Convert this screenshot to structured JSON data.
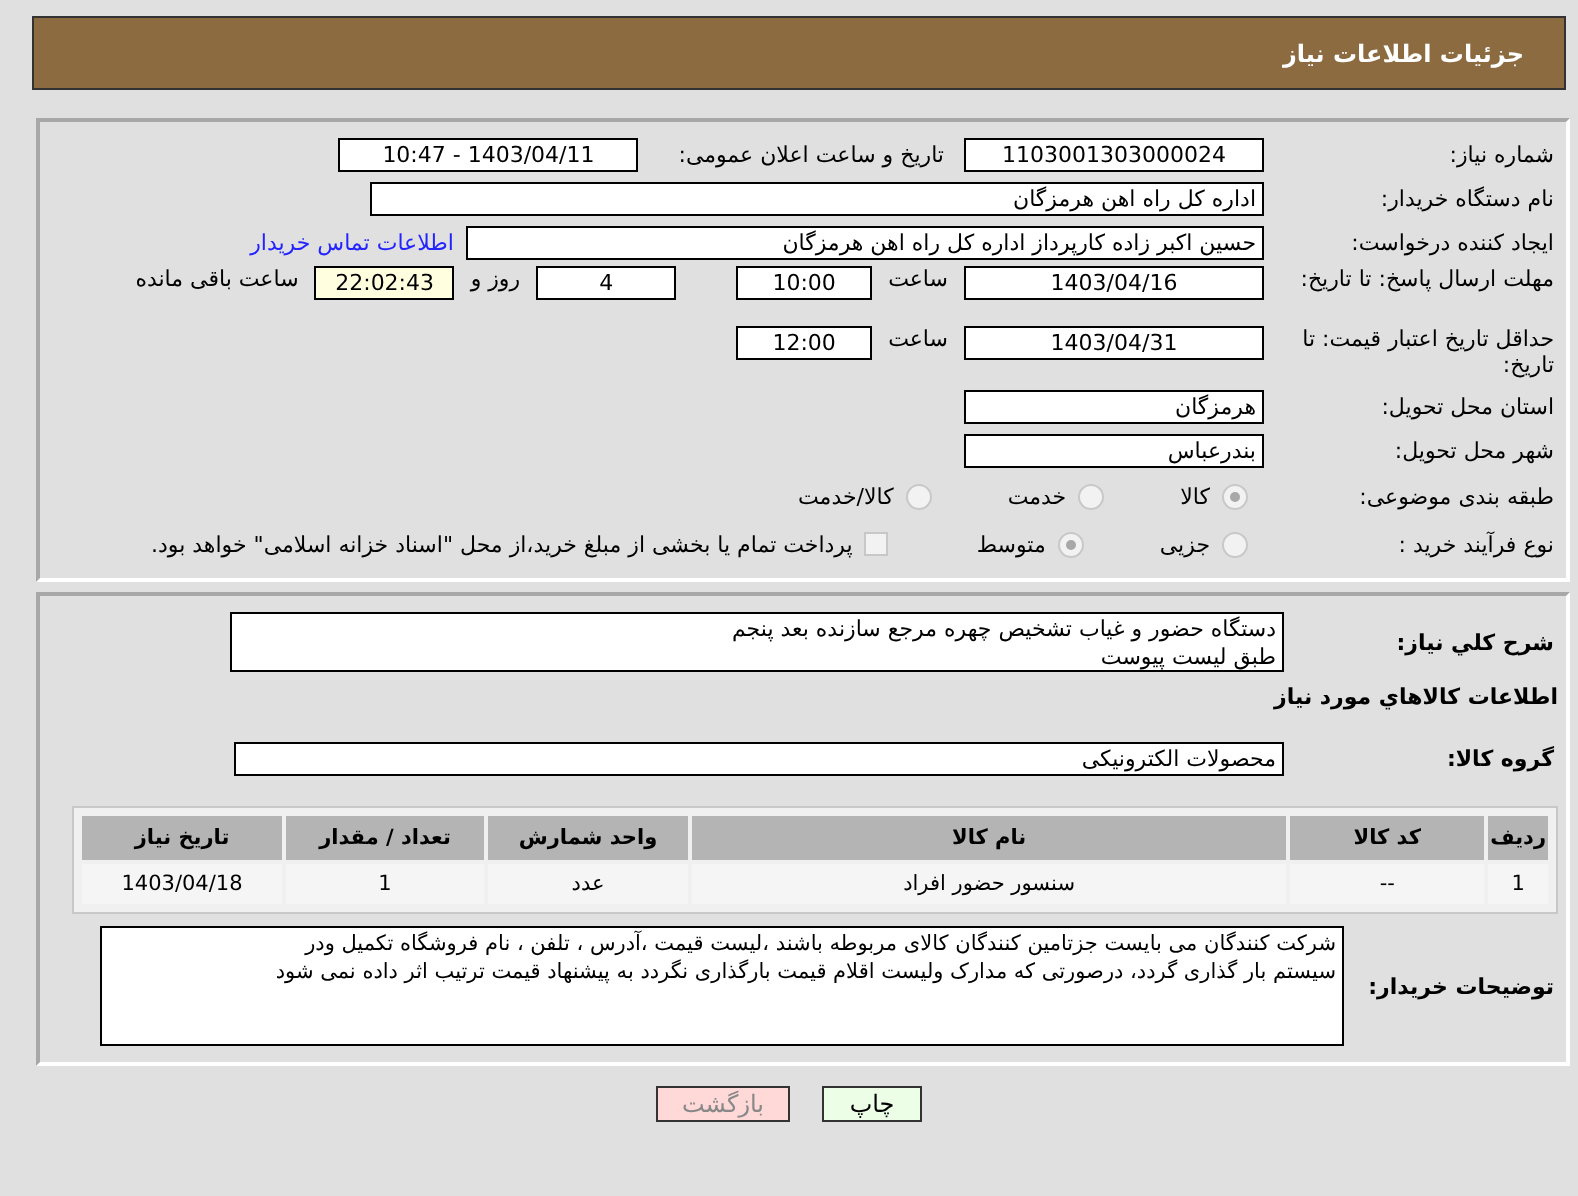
{
  "header": {
    "title": "جزئیات اطلاعات نیاز"
  },
  "need_number": {
    "label": "شماره نیاز:",
    "value": "1103001303000024",
    "announce_label": "تاریخ و ساعت اعلان عمومی:",
    "announce_value": "1403/04/11 - 10:47"
  },
  "buyer": {
    "label": "نام دستگاه خریدار:",
    "value": "اداره کل راه اهن هرمزگان"
  },
  "requester": {
    "label": "ایجاد کننده درخواست:",
    "value": "حسین اکبر زاده  کارپرداز اداره کل راه اهن هرمزگان",
    "link": "اطلاعات تماس خریدار"
  },
  "reply_deadline": {
    "label": "مهلت ارسال پاسخ: تا تاریخ:",
    "date": "1403/04/16",
    "time_label": "ساعت",
    "time": "10:00",
    "days": "4",
    "days_label": "روز و",
    "remaining": "22:02:43",
    "remaining_label": "ساعت باقی مانده"
  },
  "price_validity": {
    "label": "حداقل تاریخ اعتبار قیمت: تا تاریخ:",
    "date": "1403/04/31",
    "time_label": "ساعت",
    "time": "12:00"
  },
  "province": {
    "label": "استان محل تحویل:",
    "value": "هرمزگان"
  },
  "city": {
    "label": "شهر محل تحویل:",
    "value": "بندرعباس"
  },
  "category": {
    "label": "طبقه بندی موضوعی:",
    "options": [
      {
        "label": "کالا",
        "selected": true
      },
      {
        "label": "خدمت",
        "selected": false
      },
      {
        "label": "کالا/خدمت",
        "selected": false
      }
    ]
  },
  "process": {
    "label": "نوع فرآیند خرید :",
    "options": [
      {
        "label": "جزیی",
        "selected": false
      },
      {
        "label": "متوسط",
        "selected": true
      }
    ],
    "payment": {
      "checked": false,
      "text": "پرداخت تمام یا بخشی از مبلغ خرید،از محل \"اسناد خزانه اسلامی\" خواهد بود."
    }
  },
  "description": {
    "label": "شرح کلي نياز:",
    "lines": [
      "دستگاه حضور و غیاب تشخیص چهره مرجع سازنده بعد پنجم",
      "طبق لیست پیوست"
    ]
  },
  "goods_title": "اطلاعات کالاهاي مورد نياز",
  "goods_group": {
    "label": "گروه کالا:",
    "value": "محصولات الکترونیکی"
  },
  "table": {
    "columns": [
      "ردیف",
      "کد کالا",
      "نام کالا",
      "واحد شمارش",
      "تعداد / مقدار",
      "تاریخ نیاز"
    ],
    "rows": [
      [
        "1",
        "--",
        "سنسور حضور افراد",
        "عدد",
        "1",
        "1403/04/18"
      ]
    ]
  },
  "buyer_notes": {
    "label": "توضیحات خریدار:",
    "lines": [
      "شرکت کنندگان می بایست جزتامین کنندگان کالای مربوطه باشند ،لیست قیمت  ،آدرس ، تلفن ، نام فروشگاه تکمیل ودر",
      "سیستم بار گذاری گردد، درصورتی که مدارک ولیست اقلام قیمت بارگذاری نگردد به پیشنهاد قیمت ترتیب اثر داده نمی شود"
    ]
  },
  "buttons": [
    {
      "label": "چاپ",
      "kind": "print"
    },
    {
      "label": "بازگشت",
      "kind": "back"
    }
  ]
}
